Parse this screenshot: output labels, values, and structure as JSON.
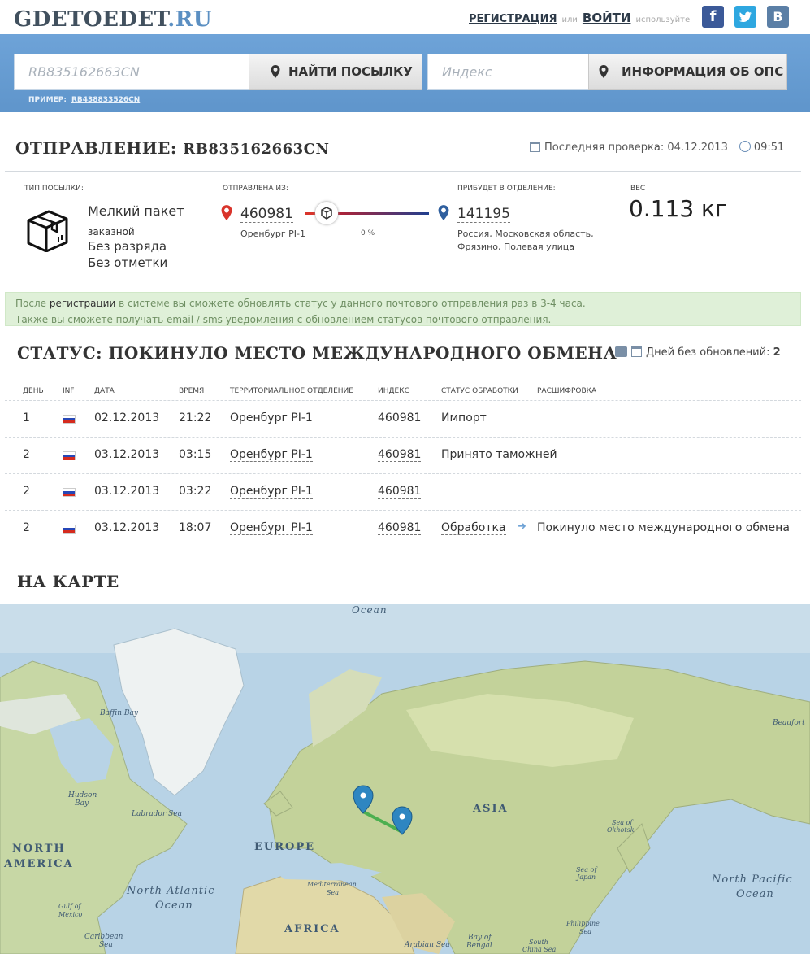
{
  "header": {
    "logo_main": "GDETOEDET",
    "logo_tld": ".RU",
    "register": "РЕГИСТРАЦИЯ",
    "or": "или",
    "login": "ВОЙТИ",
    "use": "используйте",
    "social": {
      "facebook": "f",
      "twitter": "t",
      "vk": "B"
    }
  },
  "search": {
    "track_placeholder": "RB835162663CN",
    "find_button": "НАЙТИ ПОСЫЛКУ",
    "index_placeholder": "Индекс",
    "info_button": "ИНФОРМАЦИЯ ОБ ОПС",
    "example_label": "ПРИМЕР:",
    "example_value": "RB438833526CN"
  },
  "shipment": {
    "title_prefix": "ОТПРАВЛЕНИЕ:",
    "track": "RB835162663CN",
    "last_check_label": "Последняя проверка:",
    "last_check_date": "04.12.2013",
    "last_check_time": "09:51",
    "type_label": "ТИП ПОСЫЛКИ:",
    "type": "Мелкий пакет",
    "kind": "заказной",
    "rank": "Без разряда",
    "mark": "Без отметки",
    "from_label": "ОТПРАВЛЕНА ИЗ:",
    "from_index": "460981",
    "from_city": "Оренбург PI-1",
    "progress": "0 %",
    "to_label": "ПРИБУДЕТ В ОТДЕЛЕНИЕ:",
    "to_index": "141195",
    "to_address_1": "Россия, Московская область,",
    "to_address_2": "Фрязино, Полевая улица",
    "weight_label": "ВЕС",
    "weight": "0.113 кг"
  },
  "notice": {
    "line1_a": "После ",
    "line1_link": "регистрации",
    "line1_b": " в системе вы сможете обновлять статус у данного почтового отправления раз в 3-4 часа.",
    "line2": "Также вы сможете получать email / sms уведомления с обновлением статусов почтового отправления."
  },
  "status": {
    "title": "СТАТУС: ПОКИНУЛО МЕСТО МЕЖДУНАРОДНОГО ОБМЕНА",
    "days_label": "Дней без обновлений:",
    "days_value": "2"
  },
  "table": {
    "headers": [
      "ДЕНЬ",
      "INF",
      "ДАТА",
      "ВРЕМЯ",
      "ТЕРРИТОРИАЛЬНОЕ ОТДЕЛЕНИЕ",
      "ИНДЕКС",
      "СТАТУС ОБРАБОТКИ",
      "РАСШИФРОВКА"
    ],
    "rows": [
      {
        "day": "1",
        "date": "02.12.2013",
        "time": "21:22",
        "office": "Оренбург PI-1",
        "index": "460981",
        "status": "Импорт",
        "detail": ""
      },
      {
        "day": "2",
        "date": "03.12.2013",
        "time": "03:15",
        "office": "Оренбург PI-1",
        "index": "460981",
        "status": "Принято таможней",
        "detail": ""
      },
      {
        "day": "2",
        "date": "03.12.2013",
        "time": "03:22",
        "office": "Оренбург PI-1",
        "index": "460981",
        "status": "",
        "detail": ""
      },
      {
        "day": "2",
        "date": "03.12.2013",
        "time": "18:07",
        "office": "Оренбург PI-1",
        "index": "460981",
        "status": "Обработка",
        "detail": "Покинуло место международного обмена"
      }
    ]
  },
  "map": {
    "title": "НА КАРТЕ",
    "labels": {
      "ocean_top": "Ocean",
      "baffin": "Baffin Bay",
      "beaufort": "Beaufort",
      "hudson_1": "Hudson",
      "hudson_2": "Bay",
      "labrador": "Labrador Sea",
      "asia": "ASIA",
      "okhotsk_1": "Sea of",
      "okhotsk_2": "Okhotsk",
      "north_1": "NORTH",
      "north_2": "AMERICA",
      "europe": "EUROPE",
      "japan_1": "Sea of",
      "japan_2": "Japan",
      "npac_1": "North Pacific",
      "npac_2": "Ocean",
      "natl_1": "North Atlantic",
      "natl_2": "Ocean",
      "med_1": "Mediterranean",
      "med_2": "Sea",
      "gulf_1": "Gulf of",
      "gulf_2": "Mexico",
      "carib_1": "Caribbean",
      "carib_2": "Sea",
      "africa": "AFRICA",
      "arabian": "Arabian Sea",
      "bengal_1": "Bay of",
      "bengal_2": "Bengal",
      "phil_1": "Philippine",
      "phil_2": "Sea",
      "scs_1": "South",
      "scs_2": "China Sea"
    }
  },
  "colors": {
    "brand_blue": "#6b9fd3",
    "notice_bg": "#dff0d8",
    "route_green": "#4caf50",
    "marker_blue": "#2e86c1",
    "from_pin": "#d9342b",
    "to_pin": "#2f5f9e"
  }
}
